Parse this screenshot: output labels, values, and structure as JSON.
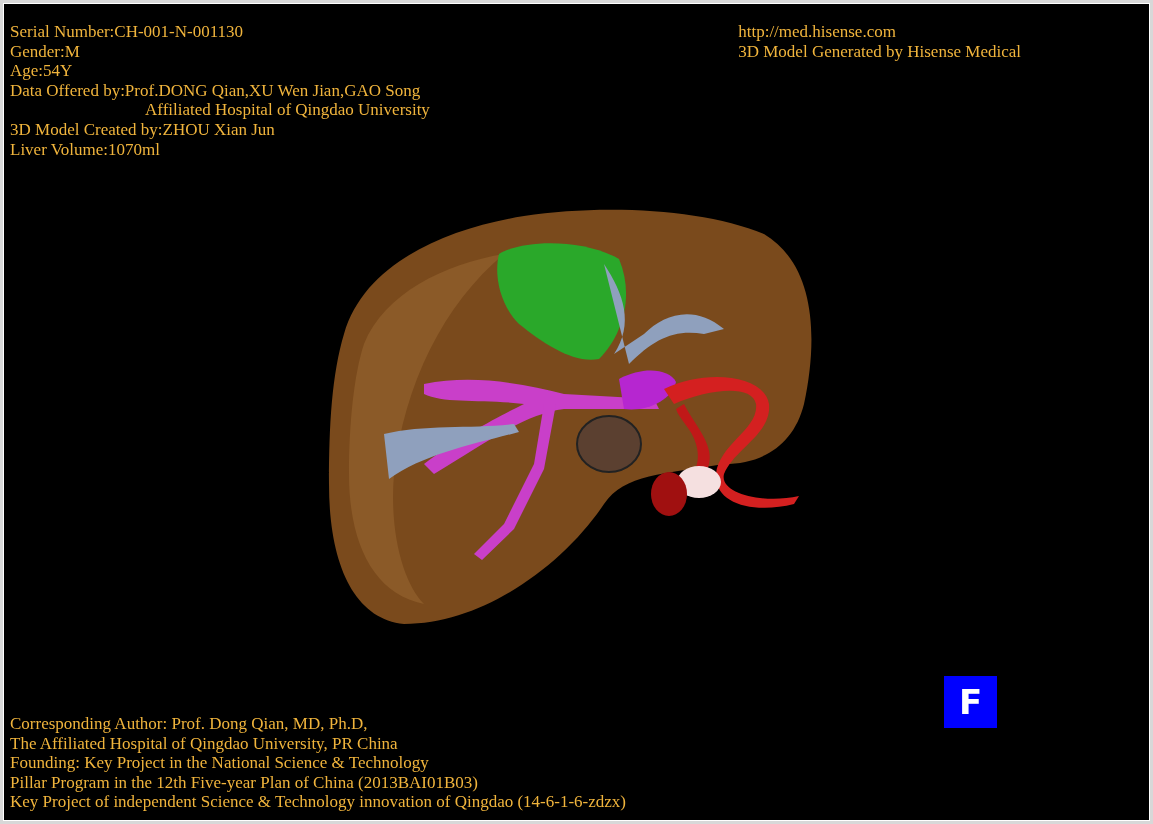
{
  "header_left": [
    {
      "text": "Serial Number:CH-001-N-001130",
      "kind": "line"
    },
    {
      "text": "Gender:M",
      "kind": "line"
    },
    {
      "text": "Age:54Y",
      "kind": "line"
    },
    {
      "text": "Data Offered by:Prof.DONG Qian,XU Wen Jian,GAO Song",
      "kind": "line"
    },
    {
      "text": "Affiliated Hospital of Qingdao University",
      "kind": "indent"
    },
    {
      "text": "3D Model Created by:ZHOU Xian Jun",
      "kind": "line"
    },
    {
      "text": "Liver Volume:1070ml",
      "kind": "line"
    }
  ],
  "header_right": [
    "http://med.hisense.com",
    "3D Model Generated by Hisense Medical"
  ],
  "orientation_marker": "F",
  "footer": [
    "Corresponding Author: Prof. Dong Qian, MD, Ph.D,",
    "The Affiliated Hospital of Qingdao University, PR China",
    "Founding: Key Project in the National Science & Technology",
    "Pillar Program in the 12th Five-year Plan of China (2013BAI01B03)",
    "Key Project of independent Science & Technology innovation of Qingdao (14-6-1-6-zdzx)"
  ]
}
